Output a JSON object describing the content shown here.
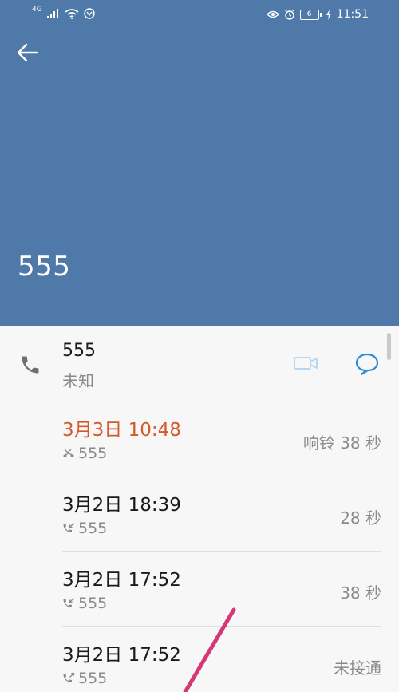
{
  "status_bar": {
    "network": "4G",
    "battery_level": "6",
    "time": "11:51"
  },
  "header": {
    "title": "555",
    "back_icon": "back-arrow-icon",
    "background_color": "#4e79a8"
  },
  "contact": {
    "number": "555",
    "location": "未知",
    "phone_icon": "phone-icon",
    "video_icon": "video-call-icon",
    "message_icon": "message-icon"
  },
  "call_log": [
    {
      "date": "3月3日 10:48",
      "number": "555",
      "status": "响铃 38 秒",
      "type": "missed"
    },
    {
      "date": "3月2日 18:39",
      "number": "555",
      "status": "28 秒",
      "type": "incoming"
    },
    {
      "date": "3月2日 17:52",
      "number": "555",
      "status": "38 秒",
      "type": "incoming"
    },
    {
      "date": "3月2日 17:52",
      "number": "555",
      "status": "未接通",
      "type": "outgoing"
    }
  ],
  "colors": {
    "accent_blue": "#2d8ad6",
    "missed_orange": "#d35a2a",
    "annotation_pink": "#d63777"
  }
}
